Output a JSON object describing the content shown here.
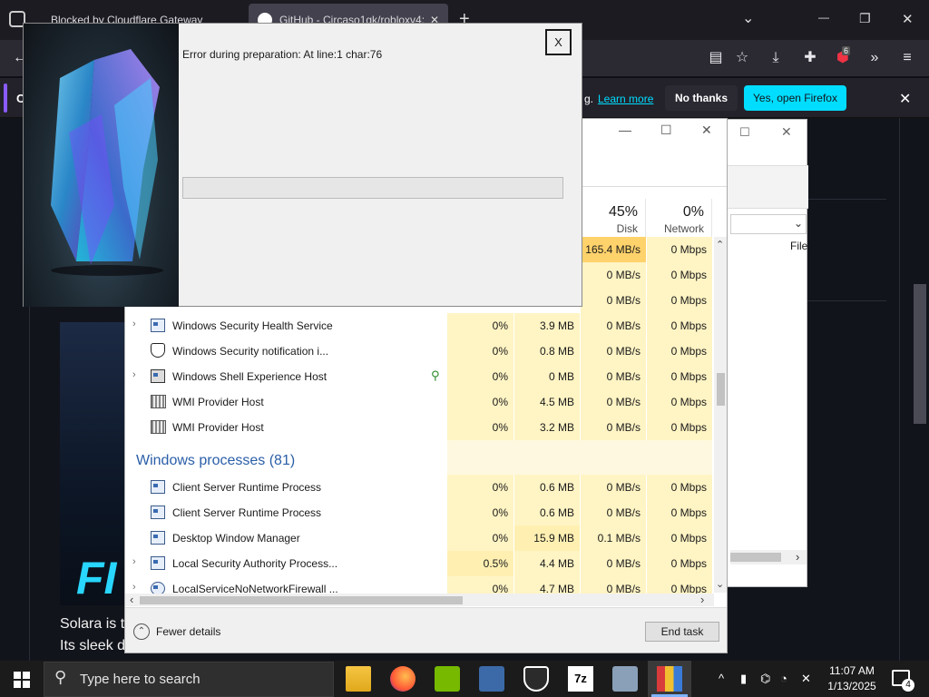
{
  "browser": {
    "tabs": [
      {
        "title": "Blocked by Cloudflare Gateway"
      },
      {
        "title": "GitHub - Circaso1gk/robloxv4:"
      }
    ],
    "new_tab": "+",
    "list_tabs": "⌄",
    "minimize": "—",
    "restore": "❐",
    "close": "✕",
    "extension_badge": "6",
    "infobar": {
      "left_text": "O",
      "text_suffix": "g.",
      "learn_more": "Learn more",
      "no_thanks": "No thanks",
      "open_firefox": "Yes, open Firefox",
      "close": "✕"
    }
  },
  "page": {
    "hero_letters": "FI",
    "line1": "Solara is ta",
    "line2": "Its sleek de"
  },
  "explorer": {
    "column_label": "File",
    "dropdown": "⌄",
    "scroll_right": "›"
  },
  "task_manager": {
    "window_controls": {
      "minimize": "—",
      "maximize": "☐",
      "close": "✕"
    },
    "columns": [
      {
        "key": "disk",
        "percent": "45%",
        "label": "Disk"
      },
      {
        "key": "network",
        "percent": "0%",
        "label": "Network"
      }
    ],
    "partial_rows": [
      {
        "disk": "165.4 MB/s",
        "network": "0 Mbps"
      },
      {
        "disk": "0 MB/s",
        "network": "0 Mbps"
      },
      {
        "disk": "0 MB/s",
        "network": "0 Mbps"
      }
    ],
    "rows": [
      {
        "name": "Windows Security Health Service",
        "cpu": "0%",
        "memory": "3.9 MB",
        "disk": "0 MB/s",
        "network": "0 Mbps",
        "expandable": true
      },
      {
        "name": "Windows Security notification i...",
        "cpu": "0%",
        "memory": "0.8 MB",
        "disk": "0 MB/s",
        "network": "0 Mbps",
        "expandable": false
      },
      {
        "name": "Windows Shell Experience Host",
        "cpu": "0%",
        "memory": "0 MB",
        "disk": "0 MB/s",
        "network": "0 Mbps",
        "expandable": true
      },
      {
        "name": "WMI Provider Host",
        "cpu": "0%",
        "memory": "4.5 MB",
        "disk": "0 MB/s",
        "network": "0 Mbps",
        "expandable": false
      },
      {
        "name": "WMI Provider Host",
        "cpu": "0%",
        "memory": "3.2 MB",
        "disk": "0 MB/s",
        "network": "0 Mbps",
        "expandable": false
      }
    ],
    "group_title": "Windows processes (81)",
    "rows2": [
      {
        "name": "Client Server Runtime Process",
        "cpu": "0%",
        "memory": "0.6 MB",
        "disk": "0 MB/s",
        "network": "0 Mbps",
        "expandable": false
      },
      {
        "name": "Client Server Runtime Process",
        "cpu": "0%",
        "memory": "0.6 MB",
        "disk": "0 MB/s",
        "network": "0 Mbps",
        "expandable": false
      },
      {
        "name": "Desktop Window Manager",
        "cpu": "0%",
        "memory": "15.9 MB",
        "disk": "0.1 MB/s",
        "network": "0 Mbps",
        "expandable": false
      },
      {
        "name": "Local Security Authority Process...",
        "cpu": "0.5%",
        "memory": "4.4 MB",
        "disk": "0 MB/s",
        "network": "0 Mbps",
        "expandable": true
      },
      {
        "name": "LocalServiceNoNetworkFirewall ...",
        "cpu": "0%",
        "memory": "4.7 MB",
        "disk": "0 MB/s",
        "network": "0 Mbps",
        "expandable": true
      }
    ],
    "scroll_up": "⌃",
    "scroll_down": "⌄",
    "scroll_left": "‹",
    "scroll_right": "›",
    "fewer_details": "Fewer details",
    "fewer_details_icon": "⌃",
    "end_task": "End task"
  },
  "dialog": {
    "message": "Error during preparation: At line:1 char:76",
    "close_label": "X"
  },
  "taskbar": {
    "search_placeholder": "Type here to search",
    "apps": [
      "file-explorer-icon",
      "firefox-icon",
      "nvidia-icon",
      "network-app-icon",
      "security-shield-icon",
      "7zip-icon",
      "photos-icon",
      "task-manager-icon"
    ],
    "app_7zip_label": "7z",
    "time": "11:07 AM",
    "date": "1/13/2025",
    "notification_count": "4",
    "tray_chevron": "^"
  },
  "colors": {
    "firefox_accent": "#00ddff",
    "tm_highlight": "#fff4c4",
    "tm_hot": "#ffd26b",
    "group_title": "#2a5ea8"
  }
}
